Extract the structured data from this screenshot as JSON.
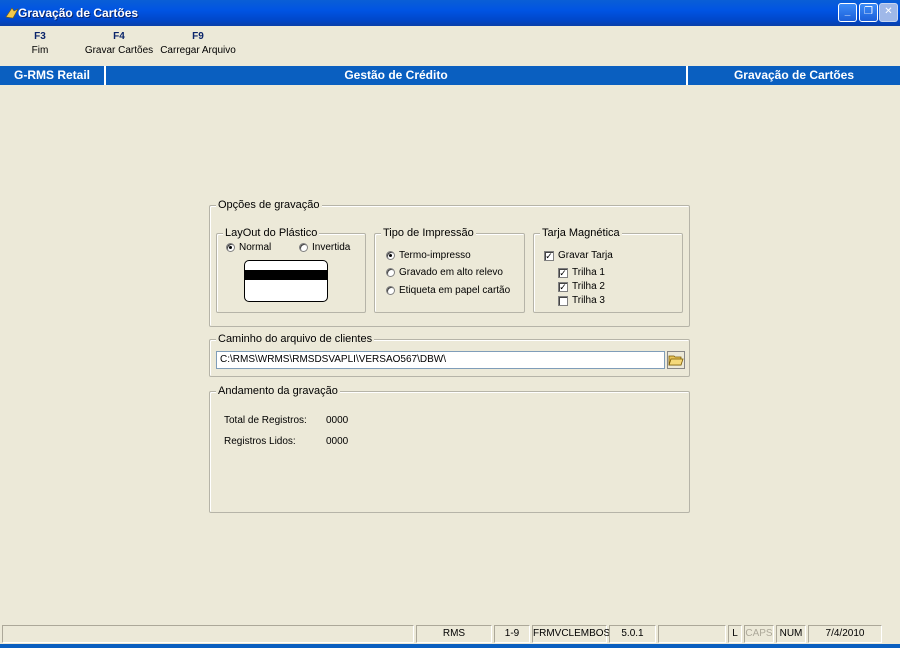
{
  "window": {
    "title": "Gravação de Cartões"
  },
  "toolbar": {
    "items": [
      {
        "key": "F3",
        "label": "Fim"
      },
      {
        "key": "F4",
        "label": "Gravar Cartões"
      },
      {
        "key": "F9",
        "label": "Carregar Arquivo"
      }
    ]
  },
  "header": {
    "left": "G-RMS Retail",
    "center": "Gestão de Crédito",
    "right": "Gravação de Cartões"
  },
  "options": {
    "legend": "Opções de gravação",
    "layout": {
      "legend": "LayOut do Plástico",
      "normal": "Normal",
      "invertida": "Invertida",
      "selected": "Normal"
    },
    "impressao": {
      "legend": "Tipo de Impressão",
      "options": [
        "Termo-impresso",
        "Gravado em alto relevo",
        "Etiqueta em papel cartão"
      ],
      "selected": "Termo-impresso"
    },
    "tarja": {
      "legend": "Tarja Magnética",
      "gravar": "Gravar Tarja",
      "trilha1": "Trilha 1",
      "trilha2": "Trilha 2",
      "trilha3": "Trilha 3",
      "gravar_checked": true,
      "trilha1_checked": true,
      "trilha2_checked": true,
      "trilha3_checked": false
    }
  },
  "caminho": {
    "legend": "Caminho do arquivo de clientes",
    "value": "C:\\RMS\\WRMS\\RMSDSVAPLI\\VERSAO567\\DBW\\"
  },
  "andamento": {
    "legend": "Andamento da gravação",
    "total_label": "Total de Registros:",
    "total_value": "0000",
    "lidos_label": "Registros Lidos:",
    "lidos_value": "0000"
  },
  "status": {
    "rms": "RMS",
    "range": "1-9",
    "form": "FRMVCLEMBOS",
    "version": "5.0.1",
    "l": "L",
    "caps": "CAPS",
    "num": "NUM",
    "date": "7/4/2010"
  },
  "icons": [
    "app-icon",
    "minimize-icon",
    "restore-icon",
    "close-icon",
    "folder-open-icon"
  ]
}
